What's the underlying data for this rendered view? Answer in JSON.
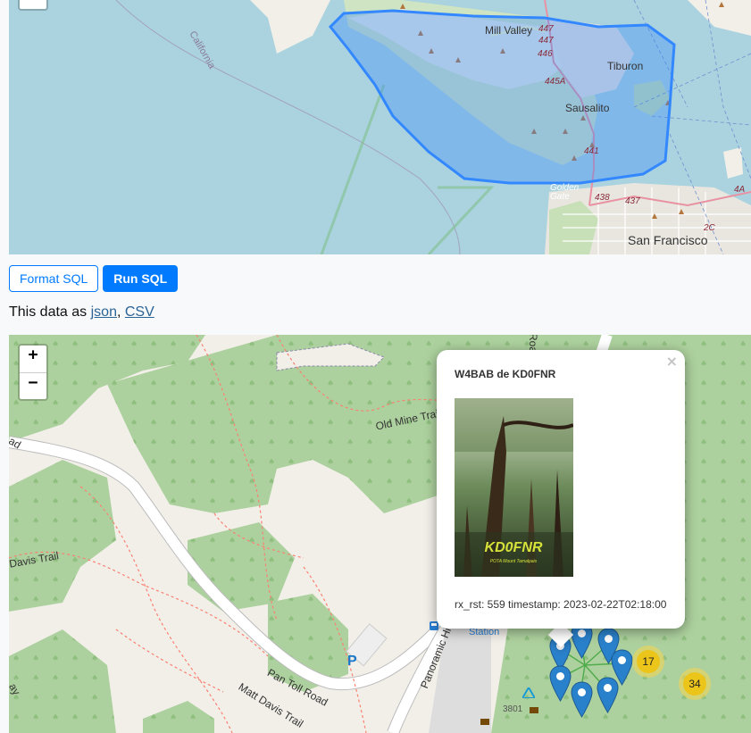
{
  "top_map": {
    "labels": {
      "mill_valley": "Mill Valley",
      "tiburon": "Tiburon",
      "sausalito": "Sausalito",
      "san_francisco": "San Francisco",
      "california": "California",
      "golden_gate": "Golden Gate"
    },
    "routes": [
      "447",
      "447",
      "446",
      "445A",
      "441",
      "438",
      "437",
      "2C",
      "4A"
    ]
  },
  "toolbar": {
    "format_label": "Format SQL",
    "run_label": "Run SQL"
  },
  "export": {
    "prefix": "This data as ",
    "json_label": "json",
    "sep": ",",
    "csv_label": "CSV"
  },
  "zoom": {
    "in": "+",
    "out": "−"
  },
  "bottom_map": {
    "roads": {
      "old_mine": "Old Mine Trail",
      "davis": "Davis Trail",
      "pan_toll": "Pan Toll Road",
      "matt_davis": "Matt Davis Trail",
      "panoramic": "Panoramic Hi",
      "station": "Station",
      "road_fragment": "Roa",
      "ad": "ad",
      "ay": "ay"
    },
    "parking": "P",
    "address": "3801",
    "clusters": [
      "17",
      "34"
    ]
  },
  "popup": {
    "title": "W4BAB de KD0FNR",
    "close": "×",
    "footer": "rx_rst: 559 timestamp: 2023-02-22T02:18:00",
    "image_caption": "KD0FNR",
    "image_subcaption": "POTA Mount Tamalpais"
  },
  "colors": {
    "accent": "#007bff",
    "water": "#aad3df",
    "forest": "#add19e",
    "marker": "#2a81cb",
    "polygon": "#3388ff"
  }
}
